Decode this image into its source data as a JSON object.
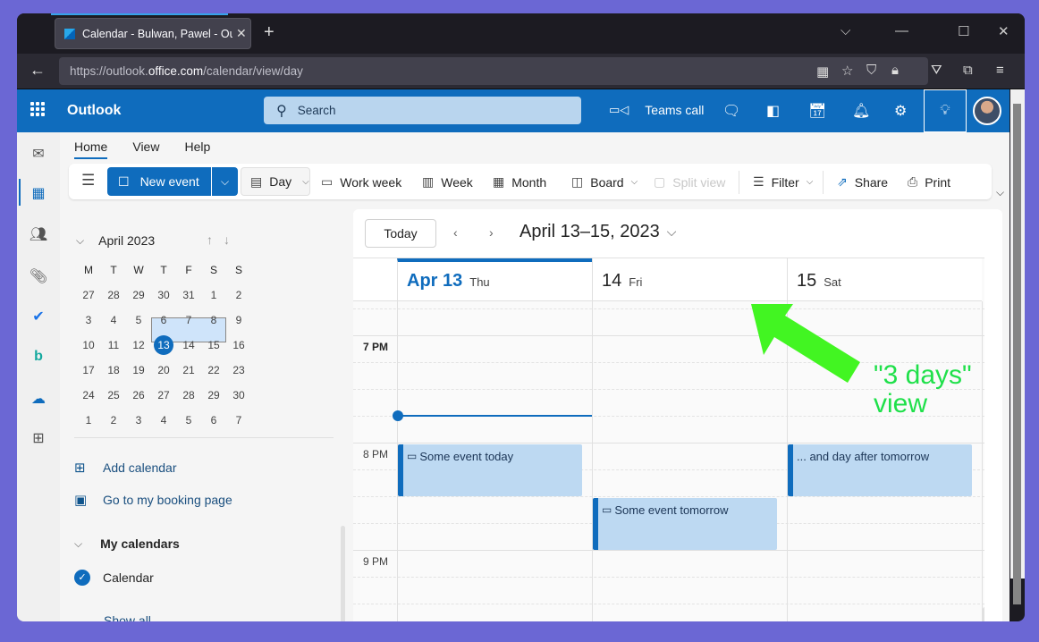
{
  "browser": {
    "tab_title": "Calendar - Bulwan, Pawel - Outlook",
    "tab_title_display": "Calendar - Bulwan, Pawel - Out",
    "url_prefix": "https://outlook.",
    "url_domain": "office.com",
    "url_path": "/calendar/view/day",
    "icons": [
      "grid-icon",
      "star-icon",
      "shield-icon",
      "lock-icon",
      "pocket-icon",
      "extensions-icon",
      "menu-icon"
    ]
  },
  "header": {
    "app_name": "Outlook",
    "search_placeholder": "Search",
    "teams_call_label": "Teams call"
  },
  "ribbon": {
    "tabs": [
      {
        "label": "Home",
        "active": true
      },
      {
        "label": "View",
        "active": false
      },
      {
        "label": "Help",
        "active": false
      }
    ],
    "new_event_label": "New event",
    "day_label": "Day",
    "work_week_label": "Work week",
    "week_label": "Week",
    "month_label": "Month",
    "board_label": "Board",
    "split_view_label": "Split view",
    "filter_label": "Filter",
    "share_label": "Share",
    "print_label": "Print"
  },
  "mini_calendar": {
    "month_label": "April 2023",
    "weekday_headers": [
      "M",
      "T",
      "W",
      "T",
      "F",
      "S",
      "S"
    ],
    "weeks": [
      [
        "27",
        "28",
        "29",
        "30",
        "31",
        "1",
        "2"
      ],
      [
        "3",
        "4",
        "5",
        "6",
        "7",
        "8",
        "9"
      ],
      [
        "10",
        "11",
        "12",
        "13",
        "14",
        "15",
        "16"
      ],
      [
        "17",
        "18",
        "19",
        "20",
        "21",
        "22",
        "23"
      ],
      [
        "24",
        "25",
        "26",
        "27",
        "28",
        "29",
        "30"
      ],
      [
        "1",
        "2",
        "3",
        "4",
        "5",
        "6",
        "7"
      ]
    ],
    "today": "13",
    "selected_range": [
      "13",
      "14",
      "15"
    ]
  },
  "left_pane": {
    "add_calendar_label": "Add calendar",
    "booking_label": "Go to my booking page",
    "my_calendars_label": "My calendars",
    "calendar_item_label": "Calendar",
    "calendar_item_checked": true,
    "show_all_label": "Show all"
  },
  "calendar": {
    "today_button": "Today",
    "range_title": "April 13–15, 2023",
    "days": [
      {
        "num": "Apr 13",
        "name": "Thu",
        "today": true
      },
      {
        "num": "14",
        "name": "Fri",
        "today": false
      },
      {
        "num": "15",
        "name": "Sat",
        "today": false
      }
    ],
    "time_labels": [
      "7 PM",
      "8 PM",
      "9 PM"
    ],
    "current_time": "7:45 PM",
    "events": [
      {
        "title": "Some event today",
        "day_index": 0,
        "start": "8:00 PM",
        "end": "8:30 PM",
        "icon": "ticket-icon"
      },
      {
        "title": "Some event tomorrow",
        "day_index": 1,
        "start": "8:30 PM",
        "end": "9:00 PM",
        "icon": "ticket-icon"
      },
      {
        "title": "... and day after tomorrow",
        "day_index": 2,
        "start": "8:00 PM",
        "end": "8:30 PM",
        "icon": null
      }
    ]
  },
  "annotation": {
    "line1": "\"3 days\"",
    "line2": "view",
    "color": "#3ef020"
  },
  "colors": {
    "brand": "#0f6cbd",
    "event_fill": "#bdd9f2"
  }
}
